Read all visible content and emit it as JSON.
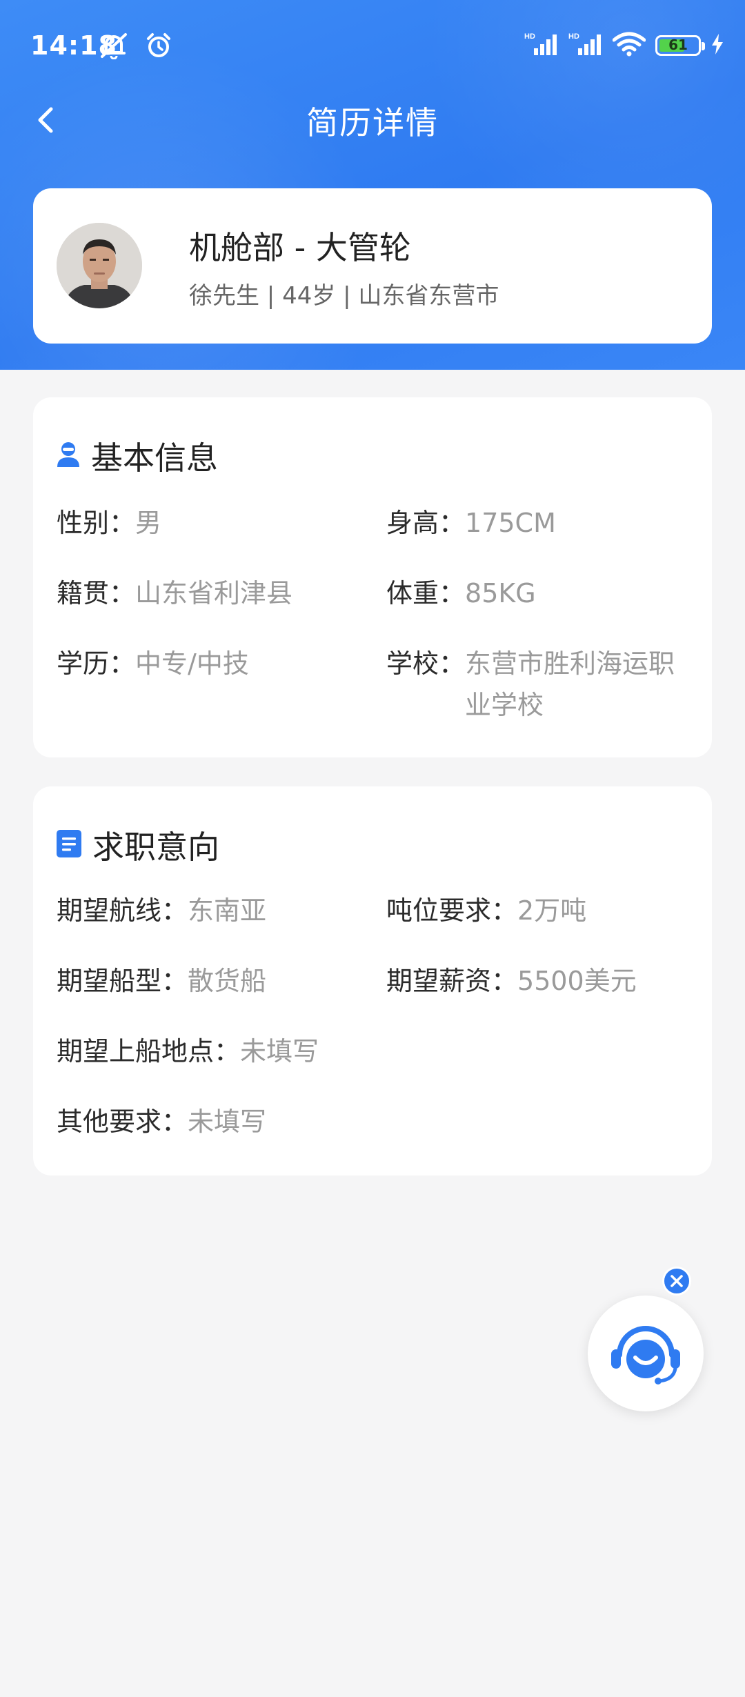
{
  "status_bar": {
    "time": "14:18",
    "battery_level": "61",
    "icons": [
      "mute-bell-icon",
      "alarm-icon",
      "hd-signal-icon",
      "hd-signal-icon",
      "wifi-icon",
      "battery-icon",
      "charging-icon"
    ]
  },
  "nav": {
    "title": "简历详情",
    "back_icon": "chevron-left-icon"
  },
  "profile": {
    "name": "机舱部 - 大管轮",
    "subtitle": "徐先生 | 44岁 | 山东省东营市"
  },
  "basic_info": {
    "title": "基本信息",
    "icon": "person-icon",
    "fields": [
      {
        "label": "性别：",
        "value": "男"
      },
      {
        "label": "身高：",
        "value": "175CM"
      },
      {
        "label": "籍贯：",
        "value": "山东省利津县"
      },
      {
        "label": "体重：",
        "value": "85KG"
      },
      {
        "label": "学历：",
        "value": "中专/中技"
      },
      {
        "label": "学校：",
        "value": "东营市胜利海运职业学校"
      }
    ]
  },
  "job_intent": {
    "title": "求职意向",
    "icon": "document-icon",
    "fields": [
      {
        "label": "期望航线：",
        "value": "东南亚"
      },
      {
        "label": "吨位要求：",
        "value": "2万吨"
      },
      {
        "label": "期望船型：",
        "value": "散货船"
      },
      {
        "label": "期望薪资：",
        "value": "5500美元"
      },
      {
        "label": "期望上船地点：",
        "value": "未填写"
      },
      {
        "label": "其他要求：",
        "value": "未填写"
      }
    ]
  },
  "colors": {
    "primary": "#2f7bf1",
    "background": "#f5f5f6",
    "label": "#2b2b2b",
    "value": "#9a9a9a"
  }
}
